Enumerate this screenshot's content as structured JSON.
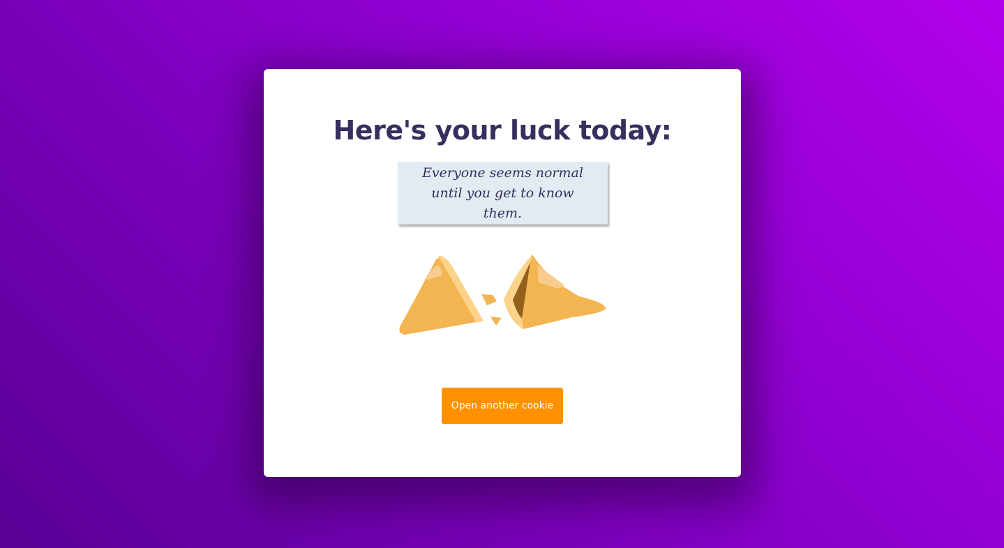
{
  "card": {
    "title": "Here's your luck today:",
    "fortune": "Everyone seems normal until you get to know them.",
    "button_label": "Open another cookie"
  },
  "colors": {
    "background_start": "#5a0096",
    "background_end": "#b100ea",
    "title": "#35305e",
    "paper": "#e3ebf2",
    "button": "#ff9100",
    "cookie": "#f2b552"
  }
}
